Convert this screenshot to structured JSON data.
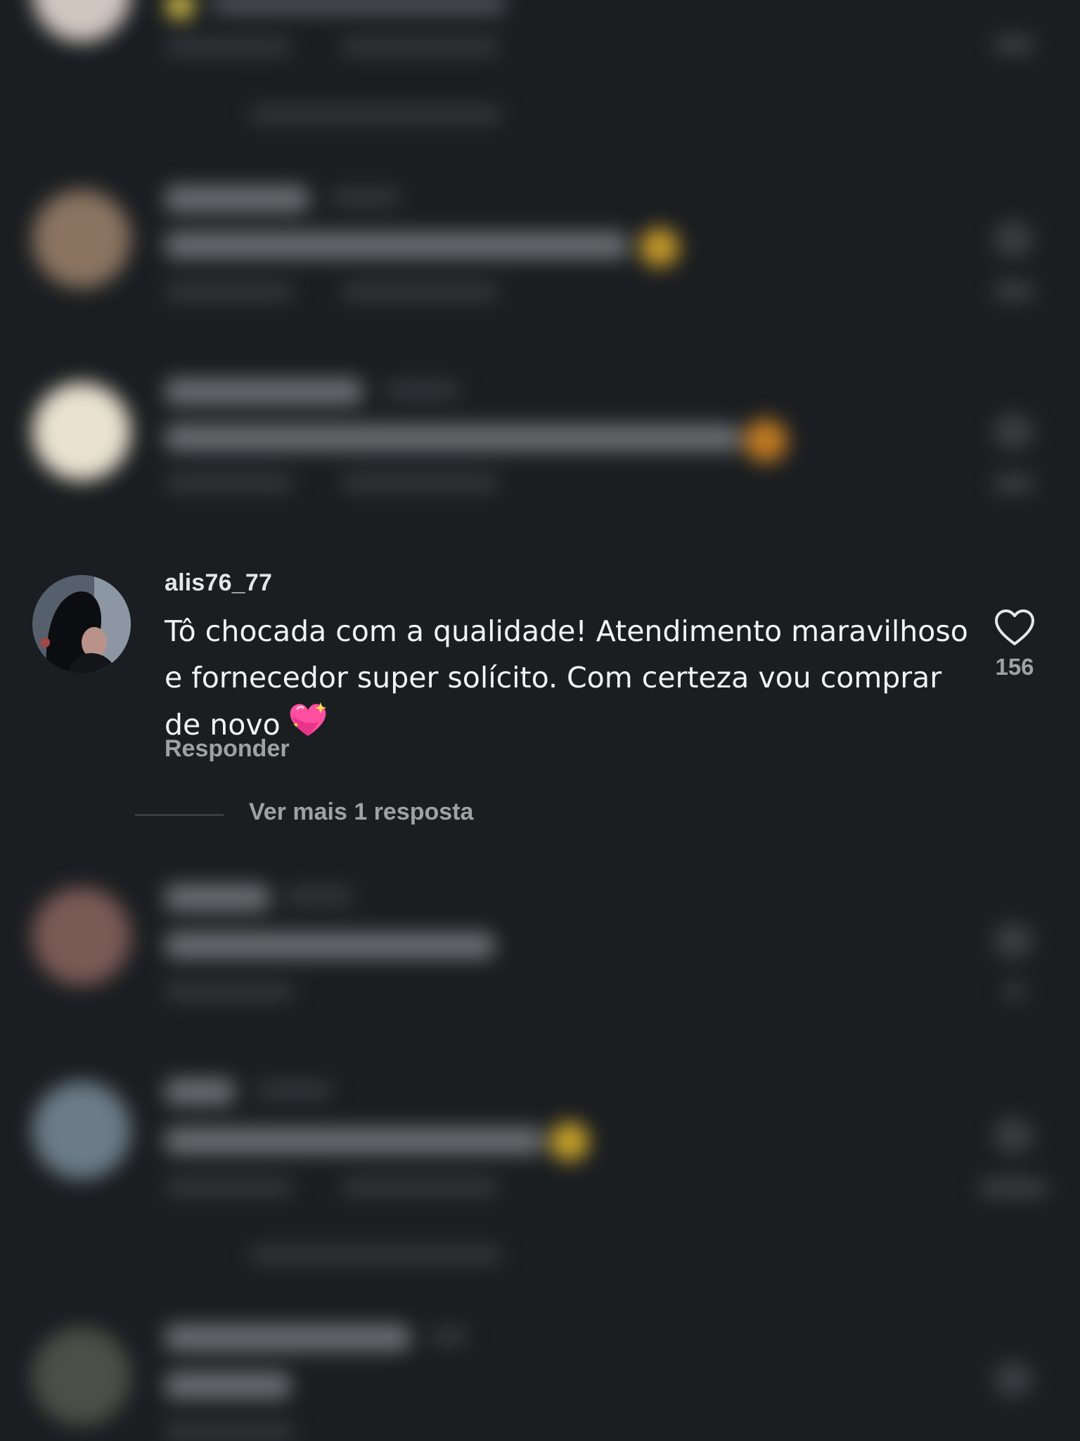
{
  "comment": {
    "username": "alis76_77",
    "text": "Tô chocada com a qualidade! Atendimento maravilhoso e fornecedor super solícito. Com certeza vou comprar de novo",
    "emoji": "💖",
    "reply_label": "Responder",
    "like_count": "156",
    "more_replies_label": "Ver mais 1 resposta"
  },
  "icons": {
    "like": "heart-outline-icon",
    "emoji": "sparkling-heart-icon"
  },
  "colors": {
    "background": "#1b1e21",
    "text_primary": "#f2f3f4",
    "text_secondary": "#9ea2a7",
    "emoji_pink": "#ff4fa0"
  }
}
